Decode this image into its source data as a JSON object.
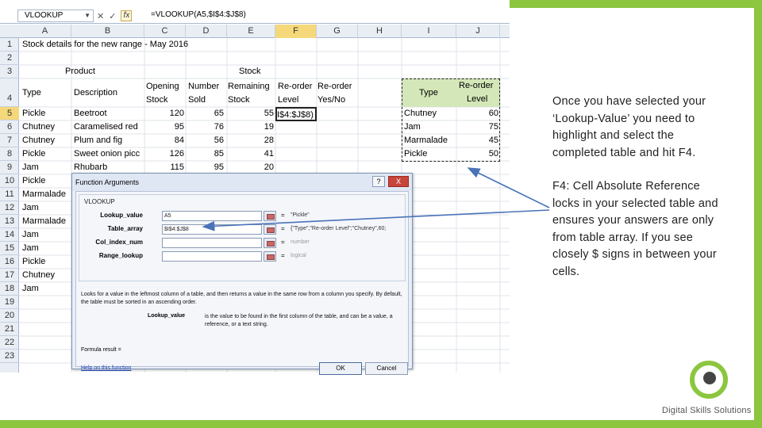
{
  "formula_bar": {
    "name_box": "VLOOKUP",
    "formula": "=VLOOKUP(A5,$I$4:$J$8)",
    "cancel_glyph": "✕",
    "enter_glyph": "✓",
    "fx_glyph": "fx"
  },
  "columns": [
    "A",
    "B",
    "C",
    "D",
    "E",
    "F",
    "G",
    "H",
    "I",
    "J"
  ],
  "rows": [
    "1",
    "2",
    "3",
    "4",
    "5",
    "6",
    "7",
    "8",
    "9",
    "10",
    "11",
    "12",
    "13",
    "14",
    "15",
    "16",
    "17",
    "18",
    "19",
    "20",
    "21",
    "22",
    "23"
  ],
  "sheet": {
    "title": "Stock details for the new range - May 2016",
    "product_header": "Product",
    "stock_header": "Stock",
    "headers": {
      "type": "Type",
      "description": "Description",
      "opening_1": "Opening",
      "opening_2": "Stock",
      "number_1": "Number",
      "number_2": "Sold",
      "remaining_1": "Remaining",
      "remaining_2": "Stock",
      "reorder_level_1": "Re-order",
      "reorder_level_2": "Level",
      "reorder_yn_1": "Re-order",
      "reorder_yn_2": "Yes/No"
    },
    "data_rows": [
      {
        "type": "Pickle",
        "desc": "Beetroot",
        "open": "120",
        "sold": "65",
        "rem": "55"
      },
      {
        "type": "Chutney",
        "desc": "Caramelised red",
        "open": "95",
        "sold": "76",
        "rem": "19"
      },
      {
        "type": "Chutney",
        "desc": "Plum and fig",
        "open": "84",
        "sold": "56",
        "rem": "28"
      },
      {
        "type": "Pickle",
        "desc": "Sweet onion picc",
        "open": "126",
        "sold": "85",
        "rem": "41"
      },
      {
        "type": "Jam",
        "desc": "Rhubarb",
        "open": "115",
        "sold": "95",
        "rem": "20"
      }
    ],
    "col_a_lower": [
      "Pickle",
      "Marmalade",
      "Jam",
      "Marmalade",
      "Jam",
      "Jam",
      "Pickle",
      "Chutney",
      "Jam"
    ],
    "editing_cell": "I$4:$J$8)"
  },
  "lookup_table": {
    "header_type": "Type",
    "header_level_1": "Re-order",
    "header_level_2": "Level",
    "rows": [
      {
        "type": "Chutney",
        "level": "60"
      },
      {
        "type": "Jam",
        "level": "75"
      },
      {
        "type": "Marmalade",
        "level": "45"
      },
      {
        "type": "Pickle",
        "level": "50"
      }
    ]
  },
  "dialog": {
    "title": "Function Arguments",
    "function_name": "VLOOKUP",
    "help_glyph": "?",
    "close_glyph": "X",
    "args": [
      {
        "label": "Lookup_value",
        "value": "A5",
        "result": "\"Pickle\""
      },
      {
        "label": "Table_array",
        "value": "$I$4:$J$8",
        "result": "{\"Type\",\"Re-order Level\";\"Chutney\",60;"
      },
      {
        "label": "Col_index_num",
        "value": "",
        "result": "number"
      },
      {
        "label": "Range_lookup",
        "value": "",
        "result": "logical"
      }
    ],
    "equals": "=",
    "description": "Looks for a value in the leftmost column of a table, and then returns a value in the same row from a column you specify. By default, the table must be sorted in an ascending order.",
    "arg_name": "Lookup_value",
    "arg_description": "is the value to be found in the first column of the table, and can be a value, a reference, or a text string.",
    "formula_result": "Formula result =",
    "help_link": "Help on this function",
    "ok": "OK",
    "cancel": "Cancel"
  },
  "explanation": {
    "paragraph1": "Once you have selected your ‘Lookup-Value’ you need to highlight and select the completed table and hit F4.",
    "paragraph2": "F4: Cell Absolute Reference locks in your selected table and ensures your answers are only from table array. If you see closely $ signs in between your cells."
  },
  "brand": {
    "name": "Digital Skills Solutions",
    "accent": "#8cc63f",
    "arrow_color": "#4a72b8"
  }
}
